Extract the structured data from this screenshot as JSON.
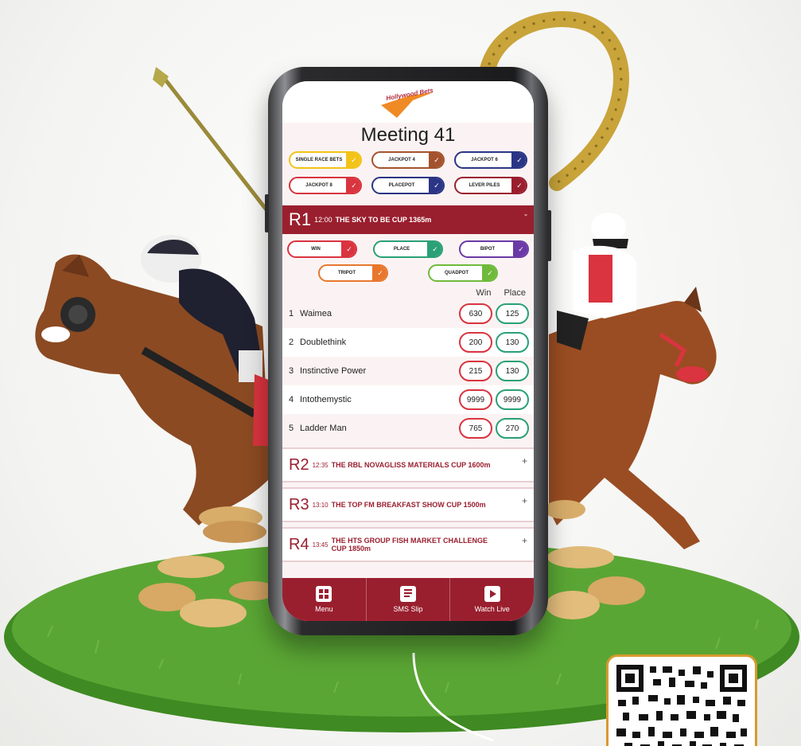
{
  "logo": {
    "text": "Hollywood Bets"
  },
  "meeting": {
    "title": "Meeting 41"
  },
  "bet_types": [
    {
      "label": "SINGLE RACE BETS",
      "color": "#f2c318"
    },
    {
      "label": "JACKPOT 4",
      "color": "#a4522d"
    },
    {
      "label": "JACKPOT 6",
      "color": "#2b3585"
    },
    {
      "label": "JACKPOT 8",
      "color": "#d9343f"
    },
    {
      "label": "PLACEPOT",
      "color": "#2b3585"
    },
    {
      "label": "LEVER PILES",
      "color": "#9a1f2e"
    }
  ],
  "race1": {
    "number": "R1",
    "time": "12:00",
    "name": "THE SKY TO BE CUP 1365m",
    "toggle": "-",
    "pools": [
      {
        "label": "WIN",
        "color": "#d9343f"
      },
      {
        "label": "PLACE",
        "color": "#2aa076"
      },
      {
        "label": "BIPOT",
        "color": "#6b3aa6"
      },
      {
        "label": "TRIPOT",
        "color": "#e8772d"
      },
      {
        "label": "QUADPOT",
        "color": "#6fba3a"
      }
    ],
    "columns": {
      "win": "Win",
      "place": "Place"
    },
    "runners": [
      {
        "num": "1",
        "name": "Waimea",
        "win": "630",
        "place": "125"
      },
      {
        "num": "2",
        "name": "Doublethink",
        "win": "200",
        "place": "130"
      },
      {
        "num": "3",
        "name": "Instinctive Power",
        "win": "215",
        "place": "130"
      },
      {
        "num": "4",
        "name": "Intothemystic",
        "win": "9999",
        "place": "9999"
      },
      {
        "num": "5",
        "name": "Ladder Man",
        "win": "765",
        "place": "270"
      }
    ]
  },
  "other_races": [
    {
      "number": "R2",
      "time": "12:35",
      "name": "THE RBL NOVAGLISS MATERIALS CUP 1600m",
      "toggle": "+"
    },
    {
      "number": "R3",
      "time": "13:10",
      "name": "THE TOP FM BREAKFAST SHOW CUP 1500m",
      "toggle": "+"
    },
    {
      "number": "R4",
      "time": "13:45",
      "name": "THE HTS GROUP FISH MARKET CHALLENGE CUP 1850m",
      "toggle": "+"
    }
  ],
  "nav": {
    "menu": "Menu",
    "sms_slip": "SMS Slip",
    "watch_live": "Watch Live"
  },
  "colors": {
    "brand": "#9a1f2e",
    "win": "#d9343f",
    "place": "#2aa076",
    "grass": "#4f9a2c",
    "horseshoe": "#c9a43a"
  }
}
